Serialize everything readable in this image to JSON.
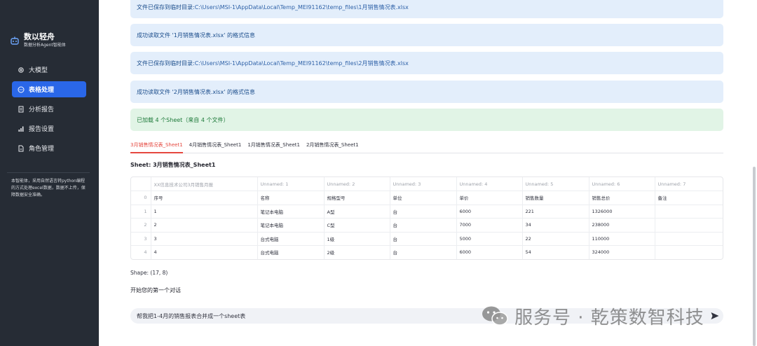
{
  "brand": {
    "title": "数以轻舟",
    "subtitle": "数据分析Agent智能体"
  },
  "nav": [
    {
      "label": "大模型",
      "icon": "gear-icon",
      "active": false
    },
    {
      "label": "表格处理",
      "icon": "chat-bubble-icon",
      "active": true
    },
    {
      "label": "分析报告",
      "icon": "document-icon",
      "active": false
    },
    {
      "label": "报告设置",
      "icon": "bar-chart-icon",
      "active": false
    },
    {
      "label": "角色管理",
      "icon": "file-icon",
      "active": false
    }
  ],
  "sidebar_note": "本智能体，采用自然语言转python编程的方式处理excel数据，数据不上传，保障数据安全准确。",
  "alerts": [
    {
      "prefix": "文件已保存到临时目录: ",
      "path": "C:\\Users\\MSI-1\\AppData\\Local\\Temp_MEI91162\\temp_files\\1月销售情况表.xlsx"
    },
    {
      "text": "成功读取文件 '1月销售情况表.xlsx' 的格式信息"
    },
    {
      "prefix": "文件已保存到临时目录: ",
      "path": "C:\\Users\\MSI-1\\AppData\\Local\\Temp_MEI91162\\temp_files\\2月销售情况表.xlsx"
    },
    {
      "text": "成功读取文件 '2月销售情况表.xlsx' 的格式信息"
    },
    {
      "text": "已加载 4 个Sheet（来自 4 个文件）"
    }
  ],
  "tabs": [
    "3月销售情况表_Sheet1",
    "4月销售情况表_Sheet1",
    "1月销售情况表_Sheet1",
    "2月销售情况表_Sheet1"
  ],
  "sheet_title": "Sheet: 3月销售情况表_Sheet1",
  "table": {
    "columns": [
      "",
      "XX信息技术公司3月销售月报",
      "Unnamed: 1",
      "Unnamed: 2",
      "Unnamed: 3",
      "Unnamed: 4",
      "Unnamed: 5",
      "Unnamed: 6",
      "Unnamed: 7"
    ],
    "rows": [
      [
        "0",
        "序号",
        "名称",
        "规格型号",
        "单位",
        "单价",
        "销售数量",
        "销售总价",
        "备注"
      ],
      [
        "1",
        "1",
        "笔记本电脑",
        "A型",
        "台",
        "6000",
        "221",
        "1326000",
        ""
      ],
      [
        "2",
        "2",
        "笔记本电脑",
        "C型",
        "台",
        "7000",
        "34",
        "238000",
        ""
      ],
      [
        "3",
        "3",
        "台式电脑",
        "1级",
        "台",
        "5000",
        "22",
        "110000",
        ""
      ],
      [
        "4",
        "4",
        "台式电脑",
        "2级",
        "台",
        "6000",
        "54",
        "324000",
        ""
      ]
    ]
  },
  "shape_text": "Shape: (17, 8)",
  "start_text": "开始您的第一个对话",
  "chat_input": {
    "value": "帮我把1-4月的销售报表合并成一个sheet表"
  },
  "watermark": "服务号 · 乾策数智科技",
  "colors": {
    "sidebar_bg": "#262c35",
    "accent": "#2a67e8",
    "tab_active": "#e5483f",
    "info_bg": "#e3eefb",
    "success_bg": "#e1f4e6"
  }
}
